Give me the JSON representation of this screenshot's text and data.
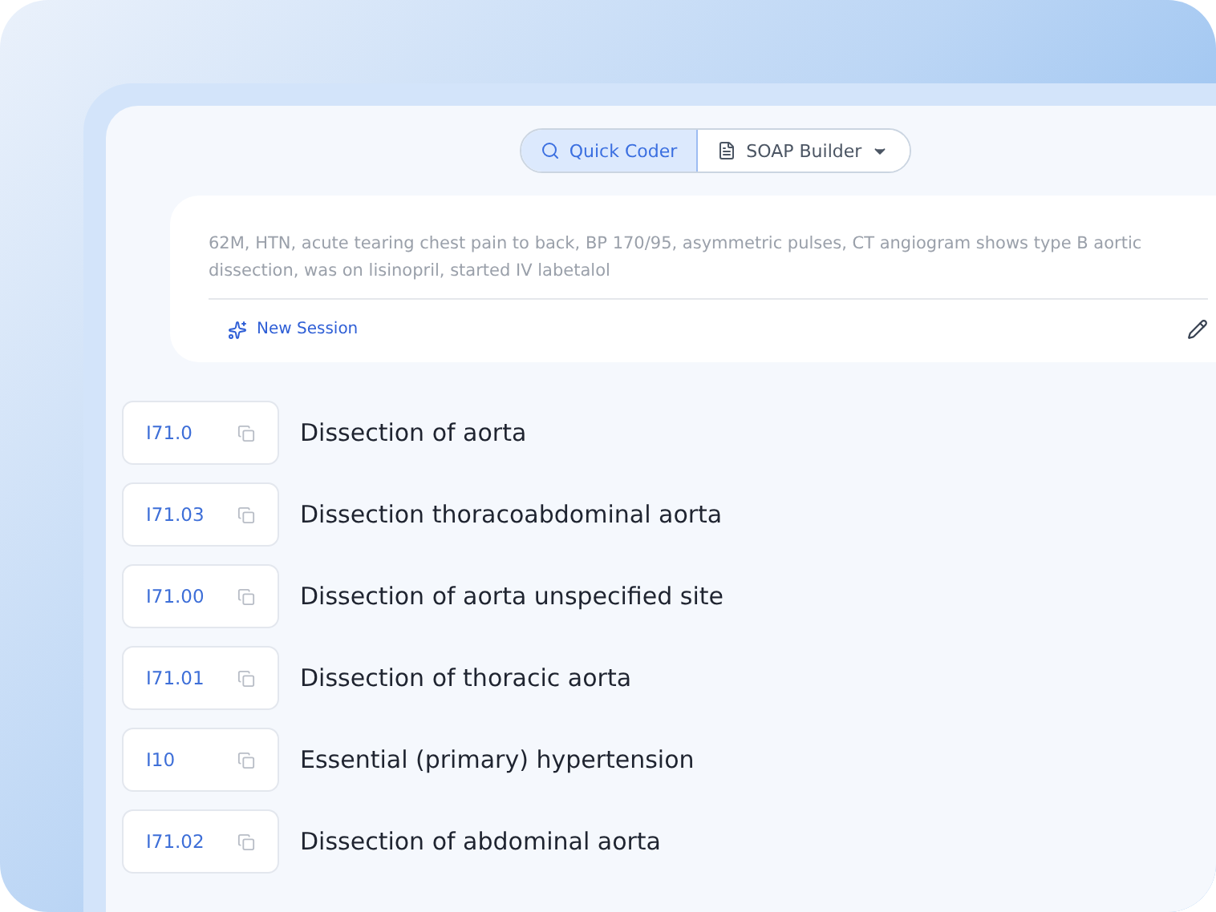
{
  "mode_toggle": [
    {
      "label": "Quick Coder",
      "selected": true,
      "kind": "search"
    },
    {
      "label": "SOAP Builder",
      "selected": false,
      "kind": "dropdown"
    }
  ],
  "note": {
    "text": "62M, HTN, acute tearing chest pain to back, BP 170/95, asymmetric pulses, CT angiogram shows type B aortic dissection, was on lisinopril, started IV labetalol",
    "new_session": "New Session"
  },
  "codes": [
    {
      "code": "I71.0",
      "description": "Dissection of aorta"
    },
    {
      "code": "I71.03",
      "description": "Dissection thoracoabdominal aorta"
    },
    {
      "code": "I71.00",
      "description": "Dissection of aorta unspecified site"
    },
    {
      "code": "I71.01",
      "description": "Dissection of thoracic aorta"
    },
    {
      "code": "I10",
      "description": "Essential (primary) hypertension"
    },
    {
      "code": "I71.02",
      "description": "Dissection of abdominal aorta"
    }
  ]
}
